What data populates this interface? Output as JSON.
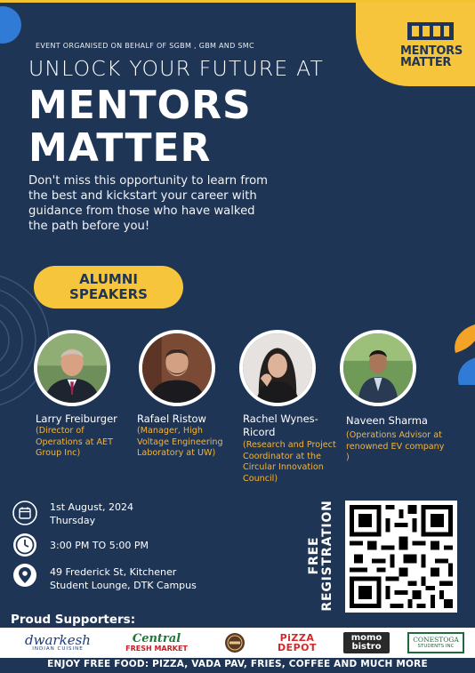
{
  "poster": {
    "organised_by": "EVENT ORGANISED ON BEHALF OF SGBM , GBM AND SMC",
    "headline_line1": "UNLOCK YOUR FUTURE AT",
    "headline_line2": "MENTORS",
    "headline_line3": "MATTER",
    "intro": "Don't miss this opportunity to learn from the best and kickstart your career with guidance from those who have walked the path before you!",
    "logo_text": "MENTORS\nMATTER"
  },
  "section": {
    "alumni_line1": "ALUMNI",
    "alumni_line2": "SPEAKERS"
  },
  "speakers": [
    {
      "name": "Larry Freiburger",
      "role": "(Director of Operations at AET Group Inc)"
    },
    {
      "name": "Rafael Ristow",
      "role": "(Manager, High Voltage Engineering Laboratory at UW)"
    },
    {
      "name": "Rachel Wynes-Ricord",
      "role": "(Research and Project Coordinator at the Circular Innovation Council)"
    },
    {
      "name": "Naveen Sharma",
      "role": "(Operations Advisor at renowned EV company )"
    }
  ],
  "event": {
    "date": "1st August, 2024",
    "day": "Thursday",
    "time": "3:00 PM TO 5:00 PM",
    "address_line1": "49 Frederick St, Kitchener",
    "address_line2": "Student Lounge, DTK Campus"
  },
  "registration": {
    "line1": "FREE",
    "line2": "REGISTRATION"
  },
  "supporters": {
    "label": "Proud Supporters:",
    "items": [
      {
        "name": "dwarkesh",
        "sub": "INDIAN CUISINE"
      },
      {
        "name": "Central",
        "sub": "FRESH MARKET"
      },
      {
        "name": "momo",
        "sub": "bistro"
      },
      {
        "name": "PiZZA",
        "sub": "DEPOT"
      },
      {
        "name": "CONESTOGA",
        "sub": "STUDENTS INC"
      }
    ]
  },
  "footer": "ENJOY FREE FOOD: PIZZA, VADA PAV, FRIES, COFFEE AND MUCH MORE",
  "colors": {
    "navy": "#1f3556",
    "gold": "#f6c53b",
    "orange": "#f3b43a",
    "blue_accent": "#2f7bd6"
  }
}
